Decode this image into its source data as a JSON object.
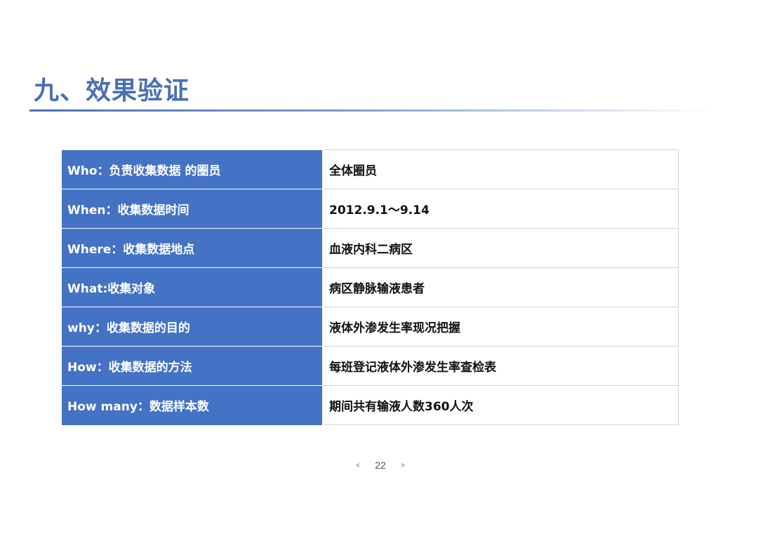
{
  "title": "九、效果验证",
  "rows": [
    {
      "key": "Who：负责收集数据 的圈员",
      "value": "全体圈员"
    },
    {
      "key": "When：收集数据时间",
      "value": "2012.9.1～9.14"
    },
    {
      "key": "Where：收集数据地点",
      "value": "血液内科二病区"
    },
    {
      "key": "What:收集对象",
      "value": "病区静脉输液患者"
    },
    {
      "key": "why：收集数据的目的",
      "value": "液体外渗发生率现况把握"
    },
    {
      "key": "How：收集数据的方法",
      "value": "每班登记液体外渗发生率查检表"
    },
    {
      "key": "How many：数据样本数",
      "value": "期间共有输液人数360人次"
    }
  ],
  "pager": {
    "page": "22",
    "prev_icon": "triangle-left-icon",
    "next_icon": "triangle-right-icon"
  },
  "colors": {
    "title": "#4a6fb5",
    "key_cell": "#4472c4",
    "value_cell": "#ffffff"
  }
}
